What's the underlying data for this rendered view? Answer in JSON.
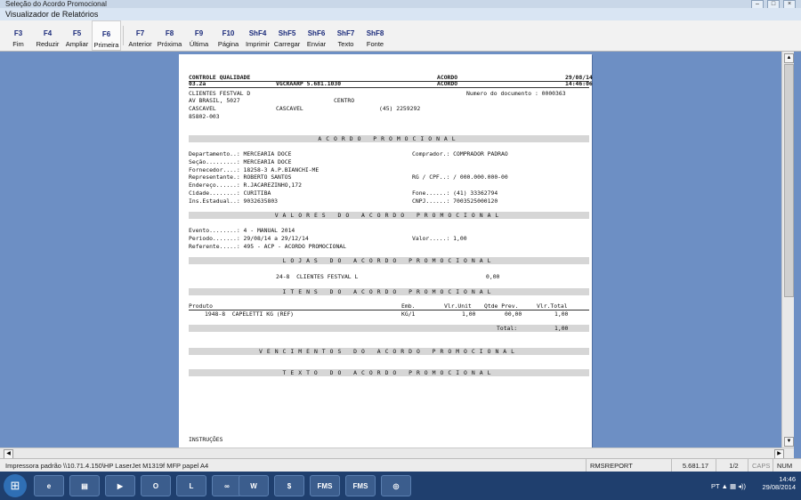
{
  "window": {
    "outer_title": "Seleção do Acordo Promocional",
    "app_title": "Visualizador de Relatórios"
  },
  "toolbar": [
    {
      "key": "F3",
      "label": "Fim"
    },
    {
      "key": "F4",
      "label": "Reduzir"
    },
    {
      "key": "F5",
      "label": "Ampliar"
    },
    {
      "key": "F6",
      "label": "Primeira"
    },
    {
      "key": "F7",
      "label": "Anterior"
    },
    {
      "key": "F8",
      "label": "Próxima"
    },
    {
      "key": "F9",
      "label": "Última"
    },
    {
      "key": "F10",
      "label": "Página"
    },
    {
      "key": "ShF4",
      "label": "Imprimir"
    },
    {
      "key": "ShF5",
      "label": "Carregar"
    },
    {
      "key": "ShF6",
      "label": "Enviar"
    },
    {
      "key": "ShF7",
      "label": "Texto"
    },
    {
      "key": "ShF8",
      "label": "Fonte"
    }
  ],
  "report": {
    "h_left1": "CONTROLE QUALIDADE",
    "h_right1": "ACORDO",
    "h_date": "29/08/14",
    "h_left2": "03.2a",
    "h_mid2": "VGCRAARP 5.681.1030",
    "h_right2": "ACORDO",
    "h_time": "14:46:06",
    "store_name": "CLIENTES FESTVAL D",
    "doc_number": "Numero do documento : 0000363",
    "store_addr": "AV BRASIL, 5027",
    "store_district": "CENTRO",
    "store_city1": "CASCAVEL",
    "store_city2": "CASCAVEL",
    "store_phone": "(45) 2259292",
    "store_cep": "85802-003",
    "title_acordo": "ACORDO PROMOCIONAL",
    "dep": "Departamento..: MERCEARIA DOCE",
    "comprador": "Comprador.: COMPRADOR PADRAO",
    "secao": "Seção.........: MERCEARIA DOCE",
    "fornecedor": "Fornecedor....: 18258-3 A.P.BIANCHI-ME",
    "rgcpf": "RG / CPF..: / 000.000.000-00",
    "representante": "Representante.: ROBERTO SANTOS",
    "endereco": "Endereço......: R.JACAREZINHO,172",
    "cidade": "Cidade........: CURITIBA",
    "fone": "Fone......: (41) 33362794",
    "ins": "Ins.Estadual..: 9032635803",
    "cnpj": "CNPJ......: 7003525000120",
    "title_valores": "VALORES DO ACORDO PROMOCIONAL",
    "evento": "Evento........: 4 - MANUAL 2014",
    "periodo": "Periodo.......: 29/08/14 a 29/12/14",
    "valor": "Valor.....: 1,00",
    "referente": "Referente.....: 495 - ACP - ACORDO PROMOCIONAL",
    "title_lojas": "LOJAS DO ACORDO PROMOCIONAL",
    "loja_row": "24-8  CLIENTES FESTVAL L",
    "loja_val": "0,00",
    "title_itens": "ITENS DO ACORDO PROMOCIONAL",
    "col_produto": "Produto",
    "col_emb": "Emb.",
    "col_vlrunit": "Vlr.Unit",
    "col_qtde": "Qtde Prev.",
    "col_vlrtotal": "Vlr.Total",
    "item_prod": "1948-8  CAPELETTI KG (REF)",
    "item_emb": "KG/1",
    "item_unit": "1,00",
    "item_qtde": "00,00",
    "item_total": "1,00",
    "total_label": "Total:",
    "total_value": "1,00",
    "title_venc": "VENCIMENTOS DO ACORDO PROMOCIONAL",
    "title_texto": "TEXTO DO ACORDO PROMOCIONAL",
    "instrucoes": "INSTRUÇÕES"
  },
  "status": {
    "printer": "Impressora padrão \\\\10.71.4.150\\HP LaserJet M1319f MFP papel A4",
    "module": "RMSREPORT",
    "version": "5.681.17",
    "page": "1/2",
    "caps": "CAPS",
    "num": "NUM"
  },
  "taskbar": {
    "apps": [
      "FMS",
      "FMS"
    ],
    "lang": "PT",
    "time": "14:46",
    "date": "29/08/2014"
  }
}
